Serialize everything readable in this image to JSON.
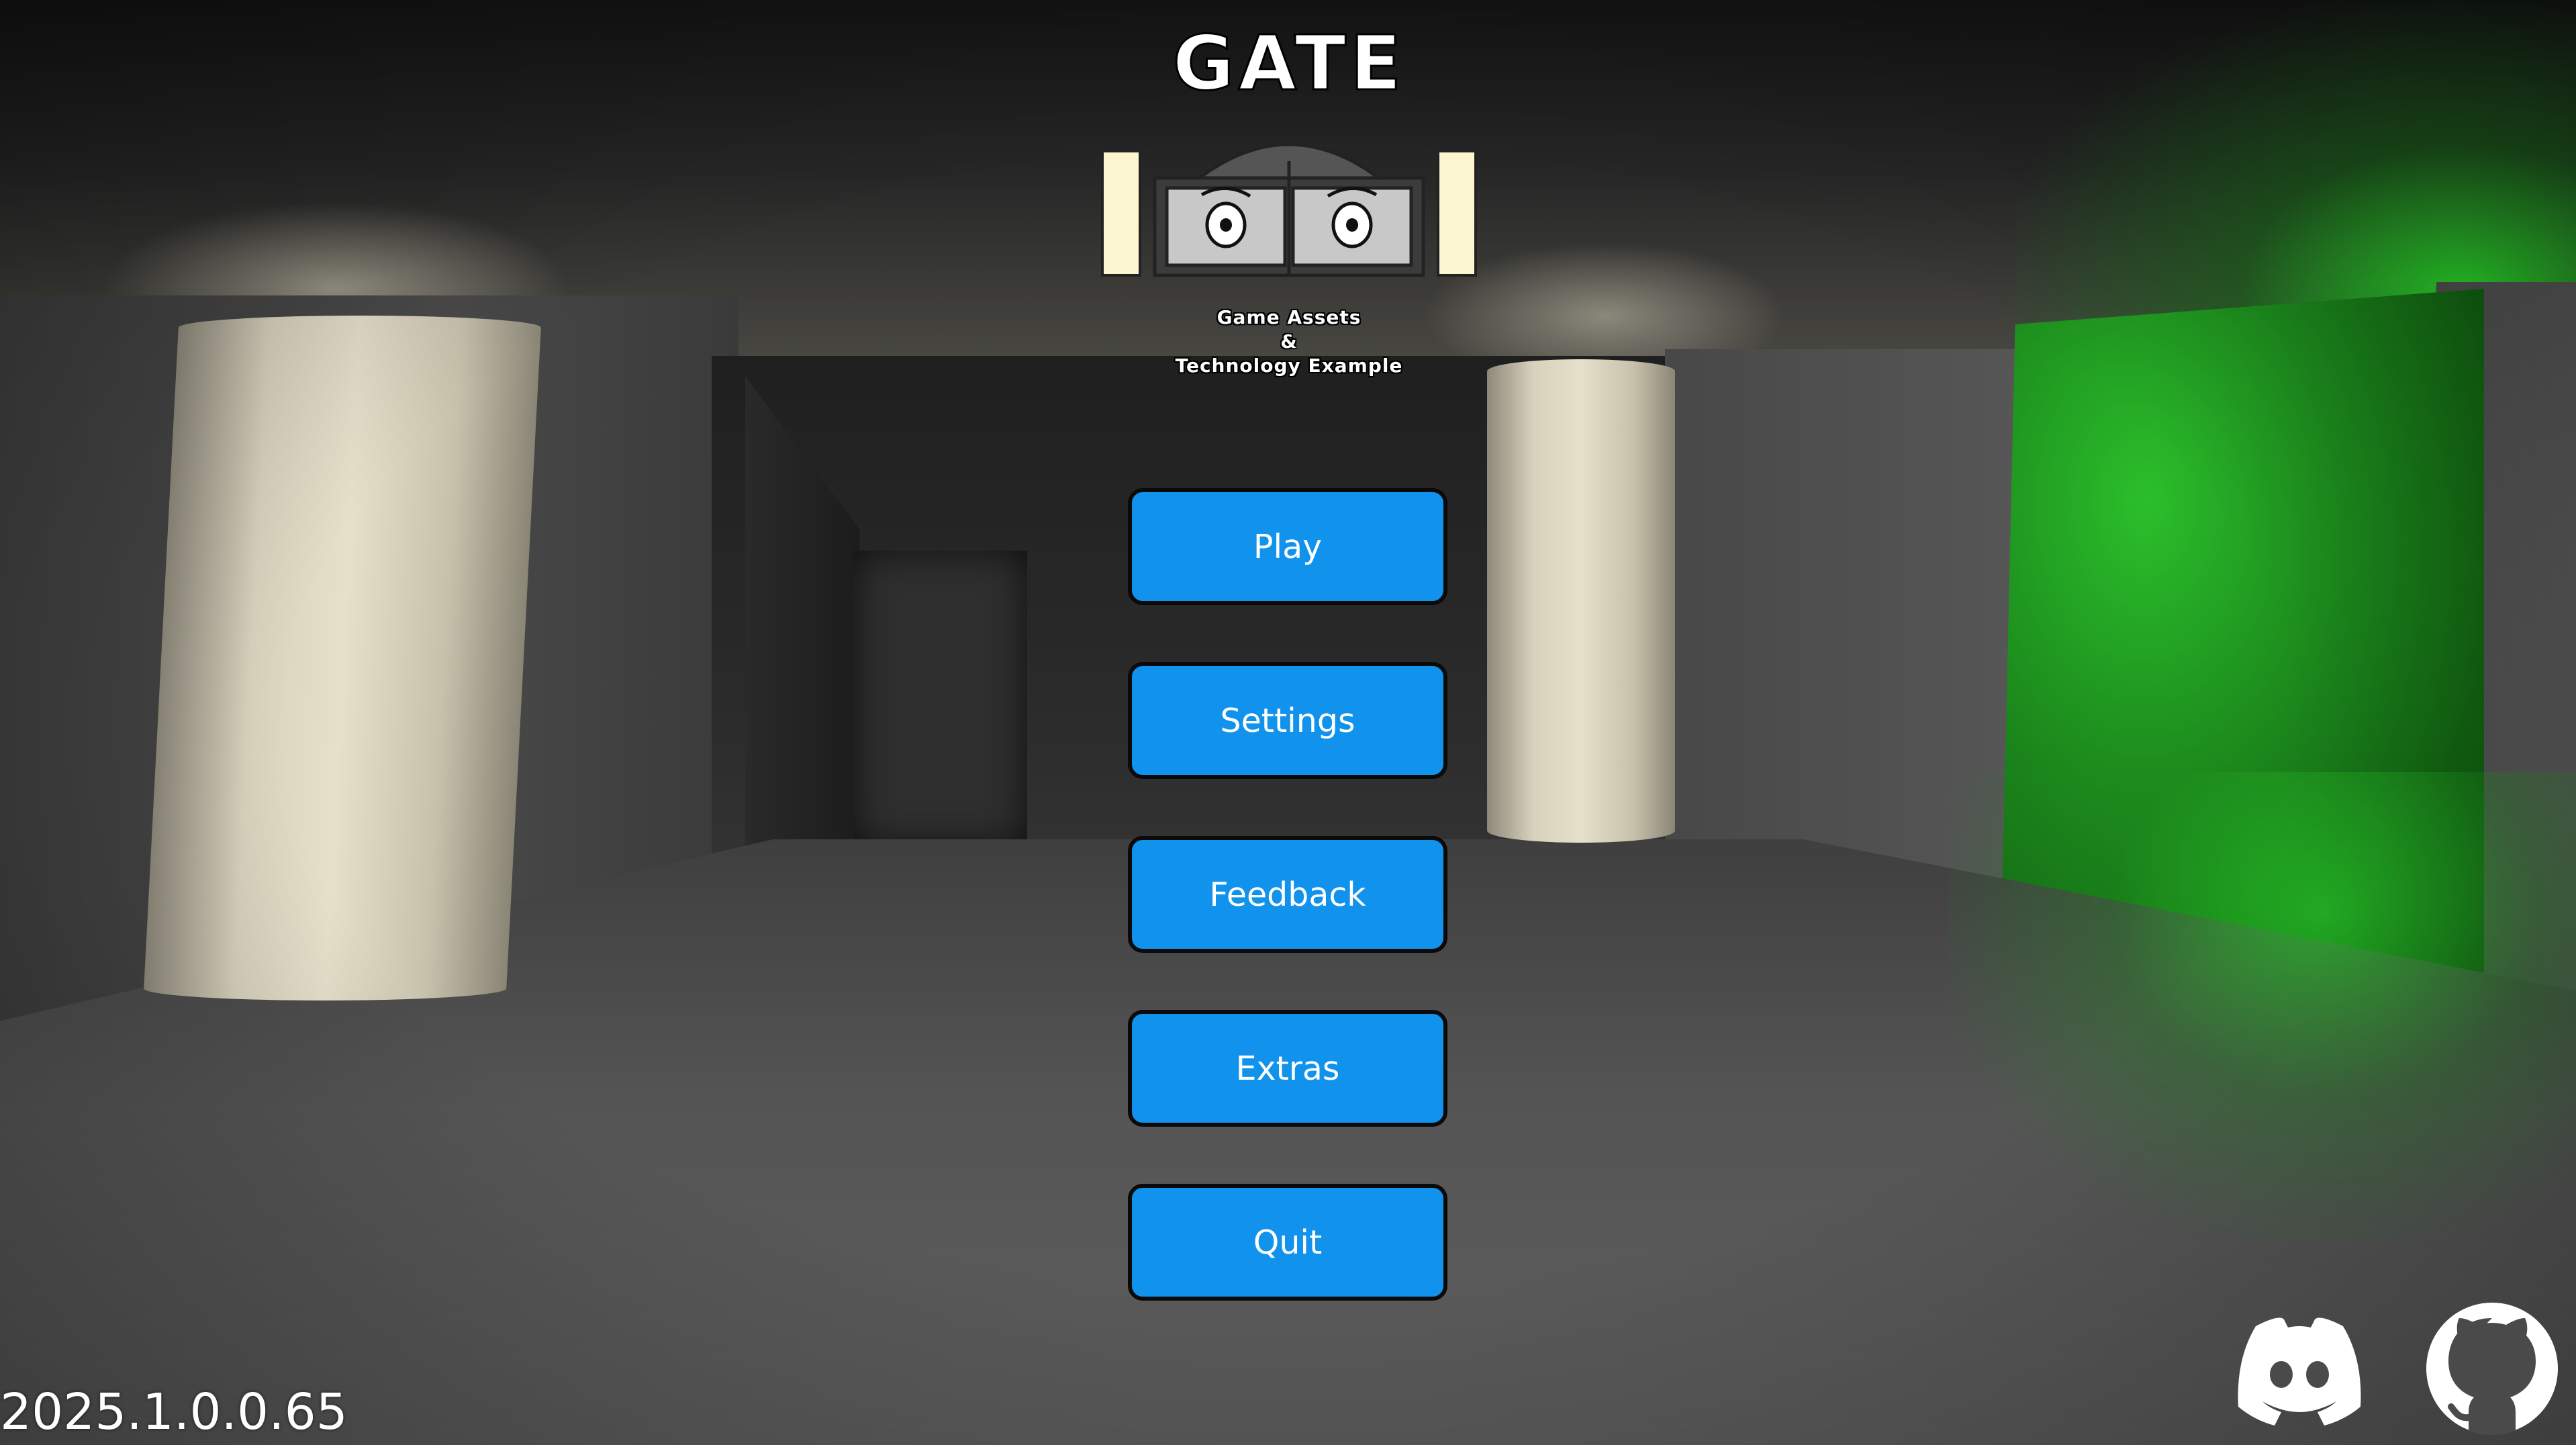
{
  "logo": {
    "title": "GATE",
    "subtitle_line1": "Game Assets",
    "subtitle_line2": "&",
    "subtitle_line3": "Technology Example"
  },
  "menu": {
    "buttons": [
      {
        "label": "Play"
      },
      {
        "label": "Settings"
      },
      {
        "label": "Feedback"
      },
      {
        "label": "Extras"
      },
      {
        "label": "Quit"
      }
    ]
  },
  "footer": {
    "version": "2025.1.0.0.65",
    "icons": [
      "discord-icon",
      "github-icon"
    ]
  },
  "colors": {
    "button_fill": "#1192ec",
    "button_border": "#0a0a0a",
    "accent_green": "#2bbf2b"
  }
}
